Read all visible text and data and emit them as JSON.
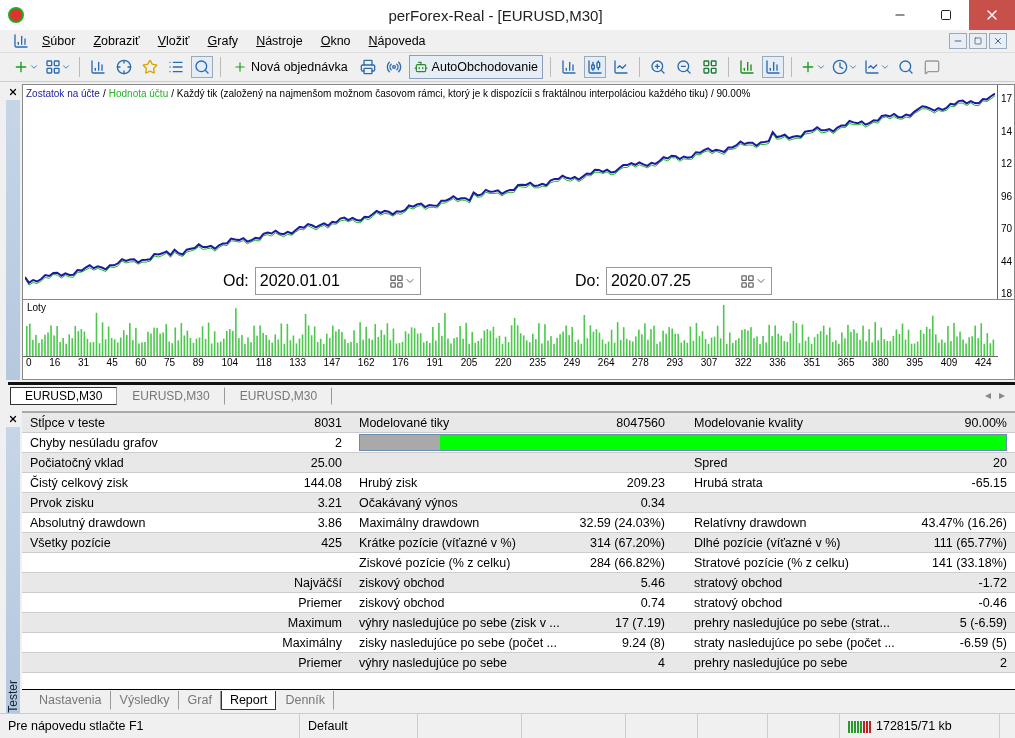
{
  "window": {
    "title": "perForex-Real - [EURUSD,M30]"
  },
  "menu": [
    "Súbor",
    "Zobraziť",
    "Vložiť",
    "Grafy",
    "Nástroje",
    "Okno",
    "Nápoveda"
  ],
  "toolbar": {
    "buttons": [
      {
        "label": "Nová objednávka",
        "selected": false
      },
      {
        "label": "AutoObchodovanie",
        "selected": true
      }
    ]
  },
  "chart": {
    "legend": [
      {
        "label": "Zostatok na účte",
        "color": "#1a1a9c"
      },
      {
        "label": "Hodnota účtu",
        "color": "#22b422"
      }
    ],
    "separator": "/",
    "description": "/ Každý tik (založený na najmenšom možnom časovom rámci, ktorý je k dispozícii s fraktálnou interpoláciou každého tiku) / 90.00%",
    "y_labels": [
      "17",
      "14",
      "12",
      "96",
      "70",
      "44",
      "18"
    ],
    "lots_title": "Loty",
    "x_labels": [
      "0",
      "16",
      "31",
      "45",
      "60",
      "75",
      "89",
      "104",
      "118",
      "133",
      "147",
      "162",
      "176",
      "191",
      "205",
      "220",
      "235",
      "249",
      "264",
      "278",
      "293",
      "307",
      "322",
      "336",
      "351",
      "365",
      "380",
      "395",
      "409",
      "424"
    ]
  },
  "date_from": {
    "label": "Od:",
    "value": "2020.01.01"
  },
  "date_to": {
    "label": "Do:",
    "value": "2020.07.25"
  },
  "chart_tab_arrows": [
    "◂",
    "▸"
  ],
  "chart_tabs": [
    {
      "label": "EURUSD,M30",
      "selected": true
    },
    {
      "label": "EURUSD,M30",
      "selected": false
    },
    {
      "label": "EURUSD,M30",
      "selected": false
    }
  ],
  "report": {
    "rows": [
      {
        "kind": "cells",
        "label_1": "Stĺpce v teste",
        "value_1": "8031",
        "label_2": "Modelované tiky",
        "value_2": "8047560",
        "label_3": "Modelovanie kvality",
        "value_3": "90.00%"
      },
      {
        "kind": "quality",
        "label_1": "Chyby nesúladu grafov",
        "value_1": "2",
        "level": 0.876
      },
      {
        "kind": "cells",
        "label_1": "Počiatočný vklad",
        "value_1": "25.00",
        "label_3": "Spred",
        "value_3": "20"
      },
      {
        "kind": "cells",
        "label_1": "Čistý celkový zisk",
        "value_1": "144.08",
        "label_2": "Hrubý zisk",
        "value_2": "209.23",
        "label_3": "Hrubá strata",
        "value_3": "-65.15"
      },
      {
        "kind": "cells",
        "label_1": "Prvok zisku",
        "value_1": "3.21",
        "label_2": "Očakávaný výnos",
        "value_2": "0.34"
      },
      {
        "kind": "cells",
        "label_1": "Absolutný drawdown",
        "value_1": "3.86",
        "label_2": "Maximálny drawdown",
        "value_2": "32.59 (24.03%)",
        "label_3": "Relatívny drawdown",
        "value_3": "43.47% (16.26)"
      },
      {
        "kind": "cells",
        "label_1": "Všetky pozície",
        "value_1": "425",
        "label_2": "Krátke pozície (víťazné v %)",
        "value_2": "314 (67.20%)",
        "label_3": "Dlhé pozície (víťazné v %)",
        "value_3": "111 (65.77%)"
      },
      {
        "kind": "cells",
        "label_2": "Ziskové pozície (% z celku)",
        "value_2": "284 (66.82%)",
        "label_3": "Stratové pozície (% z celku)",
        "value_3": "141 (33.18%)"
      },
      {
        "kind": "cells",
        "value_1": "Najväčší",
        "label_2": "ziskový obchod",
        "value_2": "5.46",
        "label_3": "stratový obchod",
        "value_3": "-1.72"
      },
      {
        "kind": "cells",
        "value_1": "Priemer",
        "label_2": "ziskový obchod",
        "value_2": "0.74",
        "label_3": "stratový obchod",
        "value_3": "-0.46"
      },
      {
        "kind": "cells",
        "value_1": "Maximum",
        "label_2": "výhry nasledujúce po sebe (zisk v ...",
        "value_2": "17 (7.19)",
        "label_3": "prehry nasledujúce po sebe (strat...",
        "value_3": "5 (-6.59)"
      },
      {
        "kind": "cells",
        "value_1": "Maximálny",
        "label_2": "zisky nasledujúce po sebe (počet ...",
        "value_2": "9.24 (8)",
        "label_3": "straty nasledujúce po sebe (počet ...",
        "value_3": "-6.59 (5)"
      },
      {
        "kind": "cells",
        "value_1": "Priemer",
        "label_2": "výhry nasledujúce po sebe",
        "value_2": "4",
        "label_3": "prehry nasledujúce po sebe",
        "value_3": "2"
      }
    ]
  },
  "tester": {
    "title": "Tester",
    "tabs": [
      {
        "label": "Nastavenia",
        "selected": false
      },
      {
        "label": "Výsledky",
        "selected": false
      },
      {
        "label": "Graf",
        "selected": false
      },
      {
        "label": "Report",
        "selected": true
      },
      {
        "label": "Denník",
        "selected": false
      }
    ]
  },
  "status_bar": {
    "help": "Pre nápovedu stlačte F1",
    "profile": "Default",
    "traffic": "172815/71 kb"
  }
}
